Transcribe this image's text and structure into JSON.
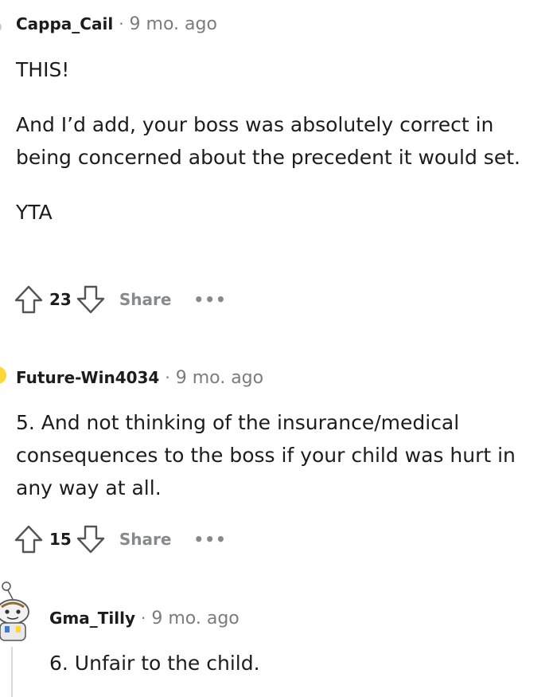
{
  "comments": [
    {
      "author": "Cappa_Cail",
      "separator": "·",
      "time": "9 mo. ago",
      "paragraphs": [
        "THIS!",
        "And I’d add, your boss was absolutely correct in being concerned about the precedent it would set.",
        "YTA"
      ],
      "score": "23",
      "share_label": "Share",
      "more_label": "•••"
    },
    {
      "author": "Future-Win4034",
      "separator": "·",
      "time": "9 mo. ago",
      "paragraphs": [
        "5. And not thinking of the insurance/medical consequences to the boss if your child was hurt in any way at all."
      ],
      "score": "15",
      "share_label": "Share",
      "more_label": "•••"
    },
    {
      "author": "Gma_Tilly",
      "separator": "·",
      "time": "9 mo. ago",
      "paragraphs": [
        "6. Unfair to the child."
      ]
    }
  ],
  "colors": {
    "text": "#1c1c1c",
    "meta": "#7c7c7c",
    "action": "#878a8c",
    "avatar_accent": "#ffd635"
  },
  "icons": {
    "upvote": "arrow-up-outline-icon",
    "downvote": "arrow-down-outline-icon"
  }
}
